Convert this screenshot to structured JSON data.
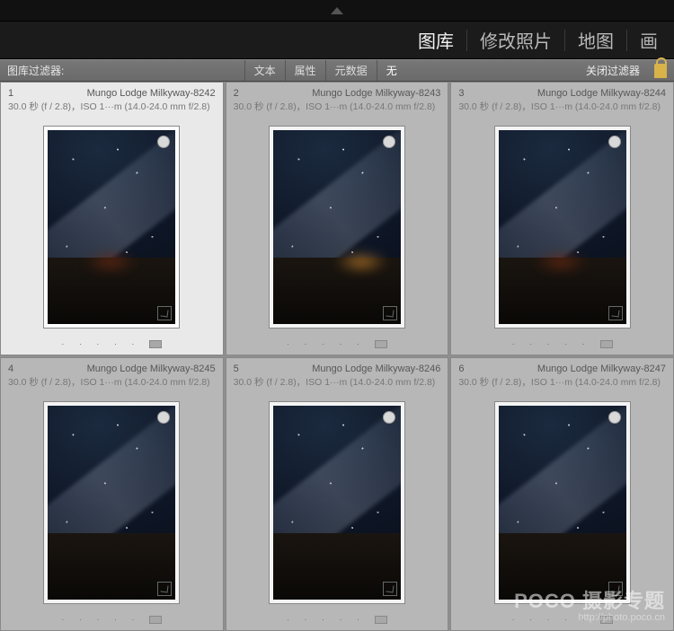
{
  "modules": {
    "library": "图库",
    "develop": "修改照片",
    "map": "地图",
    "extra": "画"
  },
  "filter": {
    "label": "图库过滤器:",
    "text": "文本",
    "attribute": "属性",
    "metadata": "元数据",
    "none": "无",
    "close": "关闭过滤器"
  },
  "common_meta": "30.0 秒 (f / 2.8)，ISO 1···m (14.0-24.0 mm f/2.8)",
  "thumbs": [
    {
      "n": "1",
      "file": "Mungo Lodge Milkyway-8242",
      "sel": true,
      "glow": "red"
    },
    {
      "n": "2",
      "file": "Mungo Lodge Milkyway-8243",
      "sel": false,
      "glow": "amber"
    },
    {
      "n": "3",
      "file": "Mungo Lodge Milkyway-8244",
      "sel": false,
      "glow": "red"
    },
    {
      "n": "4",
      "file": "Mungo Lodge Milkyway-8245",
      "sel": false,
      "glow": "none"
    },
    {
      "n": "5",
      "file": "Mungo Lodge Milkyway-8246",
      "sel": false,
      "glow": "none"
    },
    {
      "n": "6",
      "file": "Mungo Lodge Milkyway-8247",
      "sel": false,
      "glow": "none"
    }
  ],
  "watermark": {
    "brand": "POCO 摄影专题",
    "url": "http://photo.poco.cn"
  }
}
